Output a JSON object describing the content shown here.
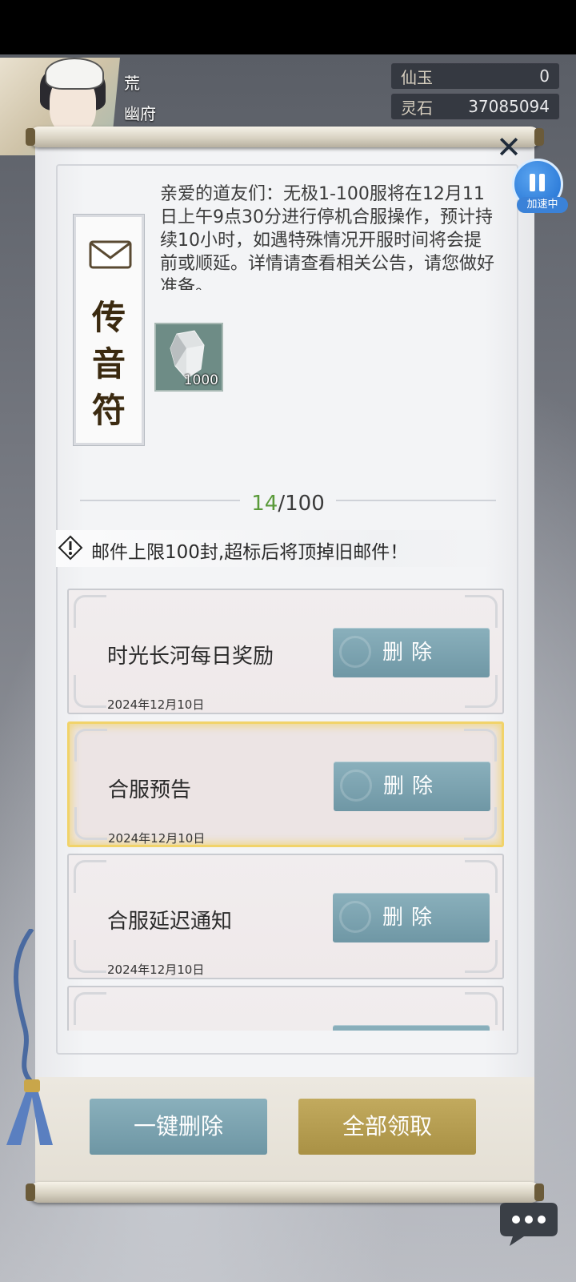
{
  "player": {
    "name_line1": "荒",
    "name_line2": "幽府"
  },
  "resources": [
    {
      "label": "仙玉",
      "value": "0"
    },
    {
      "label": "灵石",
      "value": "37085094"
    }
  ],
  "overlay": {
    "speed_label": "加速中"
  },
  "mail": {
    "tag_text": "传音符",
    "message": "亲爱的道友们：无极1-100服将在12月11日上午9点30分进行停机合服操作，预计持续10小时，如遇特殊情况开服时间将会提前或顺延。详情请查看相关公告，请您做好准备。",
    "attachment": {
      "icon": "spirit-stone-icon",
      "quantity": "1000"
    }
  },
  "counter": {
    "current": "14",
    "max": "/100"
  },
  "warning": "邮件上限100封,超标后将顶掉旧邮件！",
  "mail_list": [
    {
      "title": "时光长河每日奖励",
      "date": "2024年12月10日",
      "delete_label": "删除",
      "selected": false
    },
    {
      "title": "合服预告",
      "date": "2024年12月10日",
      "delete_label": "删除",
      "selected": true
    },
    {
      "title": "合服延迟通知",
      "date": "2024年12月10日",
      "delete_label": "删除",
      "selected": false
    },
    {
      "title": "",
      "date": "",
      "delete_label": "",
      "selected": false
    }
  ],
  "actions": {
    "delete_all": "一键删除",
    "claim_all": "全部领取"
  },
  "colors": {
    "delete_button": "#7ea4b1",
    "claim_button": "#b59d50",
    "selected_border": "#f1d36a",
    "count_current": "#5a9a3a"
  }
}
